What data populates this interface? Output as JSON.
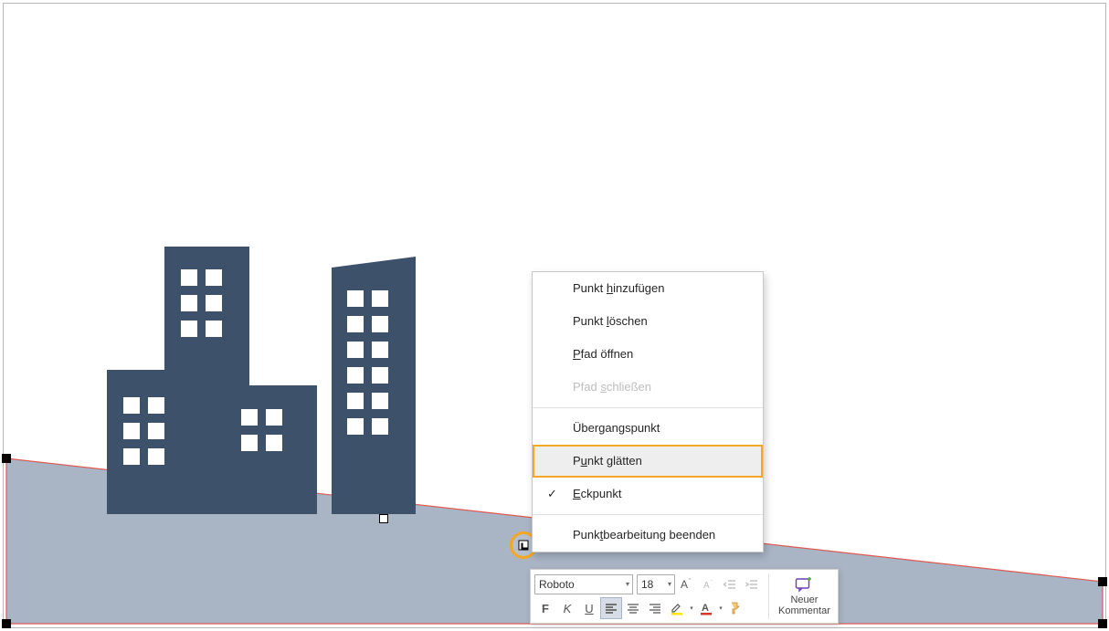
{
  "colors": {
    "building": "#3e516b",
    "polygonFill": "#a9b4c5",
    "polygonStroke": "#d74545",
    "highlight": "#f5a623"
  },
  "contextMenu": {
    "items": [
      {
        "label": "Punkt hinzufügen",
        "mnemonic": "h"
      },
      {
        "label": "Punkt löschen",
        "mnemonic": "l"
      },
      {
        "label": "Pfad öffnen",
        "mnemonic": "P"
      },
      {
        "label": "Pfad schließen",
        "mnemonic": "s",
        "disabled": true
      }
    ],
    "pointTypes": [
      {
        "label": "Übergangspunkt"
      },
      {
        "label": "Punkt glätten",
        "mnemonic": "u",
        "highlight": true
      },
      {
        "label": "Eckpunkt",
        "mnemonic": "E",
        "checked": true
      }
    ],
    "endItem": {
      "label": "Punktbearbeitung beenden",
      "mnemonic": "t"
    }
  },
  "miniToolbar": {
    "fontName": "Roboto",
    "fontSize": "18",
    "bold": "F",
    "italic": "K",
    "newComment": {
      "line1": "Neuer",
      "line2": "Kommentar"
    }
  }
}
